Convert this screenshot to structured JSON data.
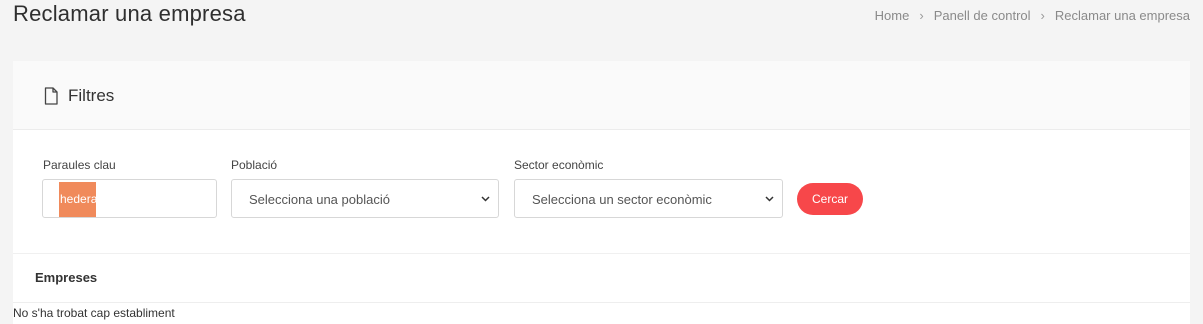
{
  "header": {
    "title": "Reclamar una empresa",
    "breadcrumb": [
      "Home",
      "Panell de control",
      "Reclamar una empresa"
    ]
  },
  "filters": {
    "title": "Filtres",
    "icon": "file-icon",
    "keyword_label": "Paraules clau",
    "keyword_value": "hedera",
    "poblacio_label": "Població",
    "poblacio_selected": "Selecciona una població",
    "sector_label": "Sector econòmic",
    "sector_selected": "Selecciona un sector econòmic",
    "search_button": "Cercar",
    "button_color": "#f7474a"
  },
  "results": {
    "title": "Empreses",
    "empty_message": "No s'ha trobat cap establiment"
  }
}
